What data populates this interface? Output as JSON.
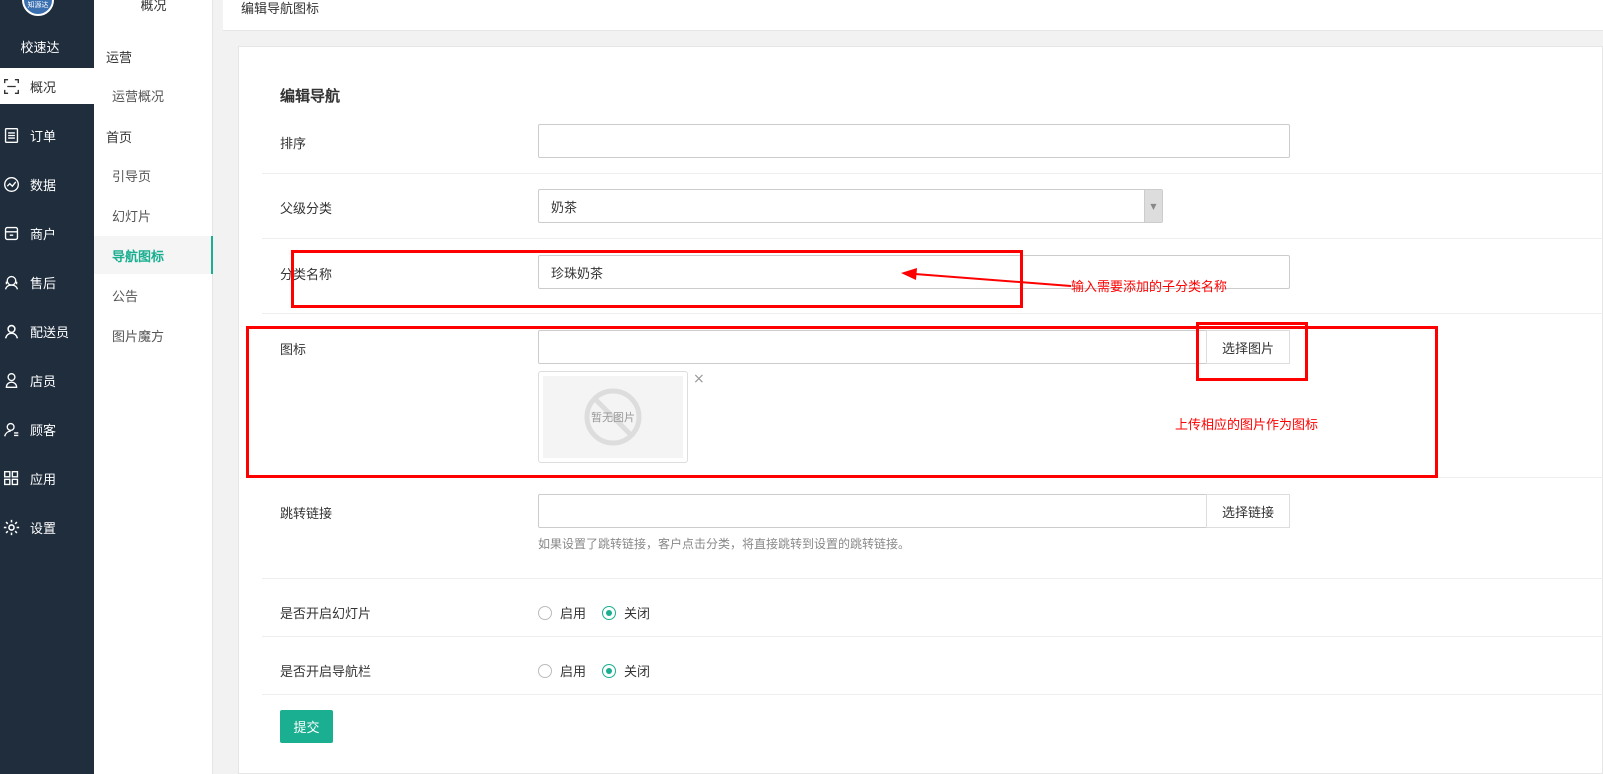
{
  "sidebar": {
    "logo_text": "知源达",
    "brand": "校速达",
    "items": [
      {
        "label": "概况",
        "icon": "scan-icon"
      },
      {
        "label": "订单",
        "icon": "list-icon"
      },
      {
        "label": "数据",
        "icon": "chart-icon"
      },
      {
        "label": "商户",
        "icon": "shop-icon"
      },
      {
        "label": "售后",
        "icon": "headset-icon"
      },
      {
        "label": "配送员",
        "icon": "user-icon"
      },
      {
        "label": "店员",
        "icon": "person-icon"
      },
      {
        "label": "顾客",
        "icon": "customer-icon"
      },
      {
        "label": "应用",
        "icon": "apps-icon"
      },
      {
        "label": "设置",
        "icon": "gear-icon"
      }
    ]
  },
  "subnav": {
    "top": "概况",
    "group_operations": "运营",
    "item_operations_overview": "运营概况",
    "group_home": "首页",
    "item_guide": "引导页",
    "item_slides": "幻灯片",
    "item_nav_icons": "导航图标",
    "item_notice": "公告",
    "item_image_magic": "图片魔方"
  },
  "header": {
    "title": "编辑导航图标"
  },
  "form": {
    "title": "编辑导航",
    "sort_label": "排序",
    "sort_value": "",
    "parent_label": "父级分类",
    "parent_value": "奶茶",
    "name_label": "分类名称",
    "name_value": "珍珠奶茶",
    "icon_label": "图标",
    "icon_value": "",
    "choose_image": "选择图片",
    "no_image": "暂无图片",
    "close_symbol": "×",
    "link_label": "跳转链接",
    "link_value": "",
    "choose_link": "选择链接",
    "link_help": "如果设置了跳转链接，客户点击分类，将直接跳转到设置的跳转链接。",
    "slides_label": "是否开启幻灯片",
    "navbar_label": "是否开启导航栏",
    "enable": "启用",
    "disable": "关闭",
    "slides_selected": "关闭",
    "navbar_selected": "关闭",
    "submit": "提交"
  },
  "annotations": {
    "name_hint": "输入需要添加的子分类名称",
    "icon_hint": "上传相应的图片作为图标"
  },
  "colors": {
    "accent": "#1aaf90",
    "sidebar_bg": "#1f2d3d",
    "annotation": "#ff0000"
  }
}
